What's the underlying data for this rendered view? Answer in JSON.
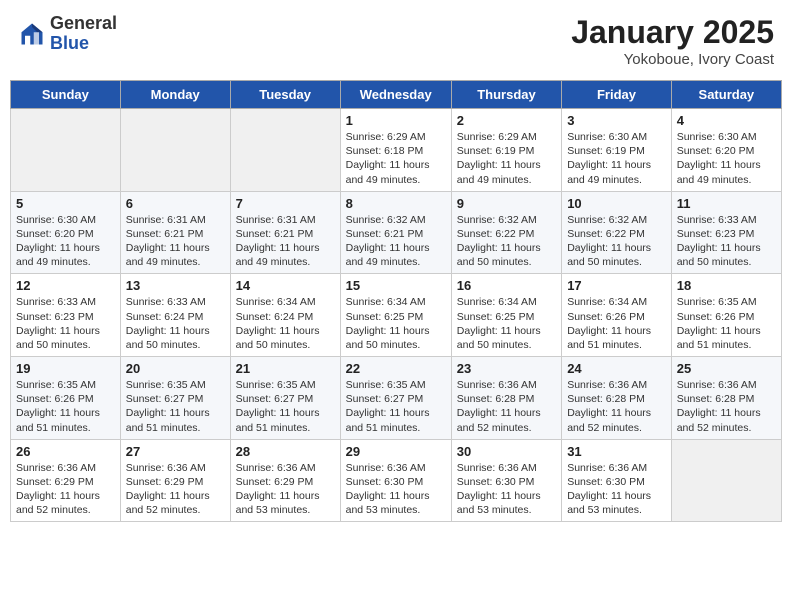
{
  "header": {
    "logo_general": "General",
    "logo_blue": "Blue",
    "month_title": "January 2025",
    "subtitle": "Yokoboue, Ivory Coast"
  },
  "weekdays": [
    "Sunday",
    "Monday",
    "Tuesday",
    "Wednesday",
    "Thursday",
    "Friday",
    "Saturday"
  ],
  "weeks": [
    [
      {
        "day": "",
        "text": ""
      },
      {
        "day": "",
        "text": ""
      },
      {
        "day": "",
        "text": ""
      },
      {
        "day": "1",
        "text": "Sunrise: 6:29 AM\nSunset: 6:18 PM\nDaylight: 11 hours\nand 49 minutes."
      },
      {
        "day": "2",
        "text": "Sunrise: 6:29 AM\nSunset: 6:19 PM\nDaylight: 11 hours\nand 49 minutes."
      },
      {
        "day": "3",
        "text": "Sunrise: 6:30 AM\nSunset: 6:19 PM\nDaylight: 11 hours\nand 49 minutes."
      },
      {
        "day": "4",
        "text": "Sunrise: 6:30 AM\nSunset: 6:20 PM\nDaylight: 11 hours\nand 49 minutes."
      }
    ],
    [
      {
        "day": "5",
        "text": "Sunrise: 6:30 AM\nSunset: 6:20 PM\nDaylight: 11 hours\nand 49 minutes."
      },
      {
        "day": "6",
        "text": "Sunrise: 6:31 AM\nSunset: 6:21 PM\nDaylight: 11 hours\nand 49 minutes."
      },
      {
        "day": "7",
        "text": "Sunrise: 6:31 AM\nSunset: 6:21 PM\nDaylight: 11 hours\nand 49 minutes."
      },
      {
        "day": "8",
        "text": "Sunrise: 6:32 AM\nSunset: 6:21 PM\nDaylight: 11 hours\nand 49 minutes."
      },
      {
        "day": "9",
        "text": "Sunrise: 6:32 AM\nSunset: 6:22 PM\nDaylight: 11 hours\nand 50 minutes."
      },
      {
        "day": "10",
        "text": "Sunrise: 6:32 AM\nSunset: 6:22 PM\nDaylight: 11 hours\nand 50 minutes."
      },
      {
        "day": "11",
        "text": "Sunrise: 6:33 AM\nSunset: 6:23 PM\nDaylight: 11 hours\nand 50 minutes."
      }
    ],
    [
      {
        "day": "12",
        "text": "Sunrise: 6:33 AM\nSunset: 6:23 PM\nDaylight: 11 hours\nand 50 minutes."
      },
      {
        "day": "13",
        "text": "Sunrise: 6:33 AM\nSunset: 6:24 PM\nDaylight: 11 hours\nand 50 minutes."
      },
      {
        "day": "14",
        "text": "Sunrise: 6:34 AM\nSunset: 6:24 PM\nDaylight: 11 hours\nand 50 minutes."
      },
      {
        "day": "15",
        "text": "Sunrise: 6:34 AM\nSunset: 6:25 PM\nDaylight: 11 hours\nand 50 minutes."
      },
      {
        "day": "16",
        "text": "Sunrise: 6:34 AM\nSunset: 6:25 PM\nDaylight: 11 hours\nand 50 minutes."
      },
      {
        "day": "17",
        "text": "Sunrise: 6:34 AM\nSunset: 6:26 PM\nDaylight: 11 hours\nand 51 minutes."
      },
      {
        "day": "18",
        "text": "Sunrise: 6:35 AM\nSunset: 6:26 PM\nDaylight: 11 hours\nand 51 minutes."
      }
    ],
    [
      {
        "day": "19",
        "text": "Sunrise: 6:35 AM\nSunset: 6:26 PM\nDaylight: 11 hours\nand 51 minutes."
      },
      {
        "day": "20",
        "text": "Sunrise: 6:35 AM\nSunset: 6:27 PM\nDaylight: 11 hours\nand 51 minutes."
      },
      {
        "day": "21",
        "text": "Sunrise: 6:35 AM\nSunset: 6:27 PM\nDaylight: 11 hours\nand 51 minutes."
      },
      {
        "day": "22",
        "text": "Sunrise: 6:35 AM\nSunset: 6:27 PM\nDaylight: 11 hours\nand 51 minutes."
      },
      {
        "day": "23",
        "text": "Sunrise: 6:36 AM\nSunset: 6:28 PM\nDaylight: 11 hours\nand 52 minutes."
      },
      {
        "day": "24",
        "text": "Sunrise: 6:36 AM\nSunset: 6:28 PM\nDaylight: 11 hours\nand 52 minutes."
      },
      {
        "day": "25",
        "text": "Sunrise: 6:36 AM\nSunset: 6:28 PM\nDaylight: 11 hours\nand 52 minutes."
      }
    ],
    [
      {
        "day": "26",
        "text": "Sunrise: 6:36 AM\nSunset: 6:29 PM\nDaylight: 11 hours\nand 52 minutes."
      },
      {
        "day": "27",
        "text": "Sunrise: 6:36 AM\nSunset: 6:29 PM\nDaylight: 11 hours\nand 52 minutes."
      },
      {
        "day": "28",
        "text": "Sunrise: 6:36 AM\nSunset: 6:29 PM\nDaylight: 11 hours\nand 53 minutes."
      },
      {
        "day": "29",
        "text": "Sunrise: 6:36 AM\nSunset: 6:30 PM\nDaylight: 11 hours\nand 53 minutes."
      },
      {
        "day": "30",
        "text": "Sunrise: 6:36 AM\nSunset: 6:30 PM\nDaylight: 11 hours\nand 53 minutes."
      },
      {
        "day": "31",
        "text": "Sunrise: 6:36 AM\nSunset: 6:30 PM\nDaylight: 11 hours\nand 53 minutes."
      },
      {
        "day": "",
        "text": ""
      }
    ]
  ]
}
